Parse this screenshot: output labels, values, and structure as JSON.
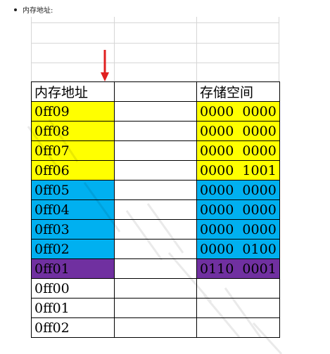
{
  "bullet": {
    "text": "内存地址:"
  },
  "table": {
    "header": {
      "address": "内存地址",
      "middle": "",
      "storage": "存储空间"
    },
    "rows": [
      {
        "address": "0ff09",
        "storage": "0000  0000",
        "color": "#ffff00"
      },
      {
        "address": "0ff08",
        "storage": "0000  0000",
        "color": "#ffff00"
      },
      {
        "address": "0ff07",
        "storage": "0000  0000",
        "color": "#ffff00"
      },
      {
        "address": "0ff06",
        "storage": "0000  1001",
        "color": "#ffff00"
      },
      {
        "address": "0ff05",
        "storage": "0000  0000",
        "color": "#00b0f0"
      },
      {
        "address": "0ff04",
        "storage": "0000  0000",
        "color": "#00b0f0"
      },
      {
        "address": "0ff03",
        "storage": "0000  0000",
        "color": "#00b0f0"
      },
      {
        "address": "0ff02",
        "storage": "0000  0100",
        "color": "#00b0f0"
      },
      {
        "address": "0ff01",
        "storage": "0110  0001",
        "color": "#7030a0"
      },
      {
        "address": "0ff00",
        "storage": "",
        "color": "#ffffff"
      },
      {
        "address": "0ff01",
        "storage": "",
        "color": "#ffffff"
      },
      {
        "address": "0ff02",
        "storage": "",
        "color": "#ffffff"
      }
    ]
  },
  "colors": {
    "arrow": "#e02020",
    "grid": "#d6d6d6"
  }
}
